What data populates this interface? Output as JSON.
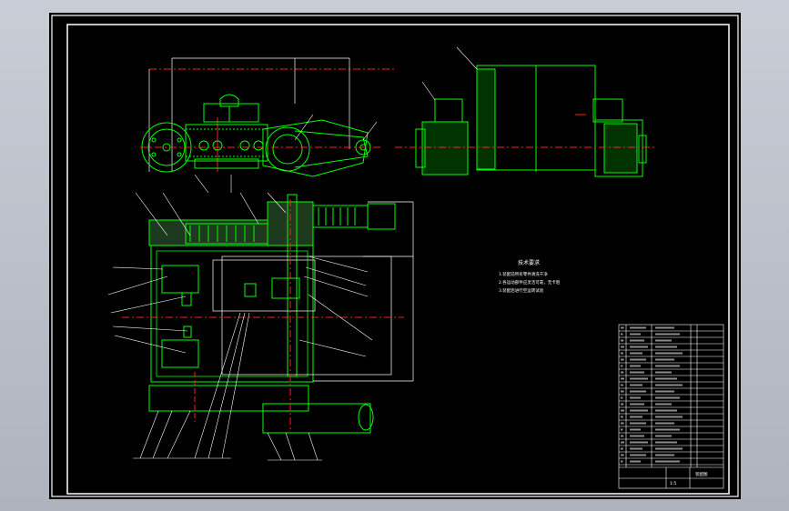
{
  "drawing": {
    "colors": {
      "background": "#000000",
      "frame": "#ffffff",
      "outline": "#00ff00",
      "center_line": "#ff2020",
      "text": "#ffffff",
      "pink": "#ff80ff"
    },
    "notes": {
      "title": "技术要求",
      "lines": [
        "1.装配前所有零件清洗干净",
        "2.各运动部件应灵活可靠，无卡阻",
        "3.装配后进行空运转试验"
      ]
    },
    "title_block": {
      "name": "装配图",
      "scale": "1:5"
    }
  }
}
